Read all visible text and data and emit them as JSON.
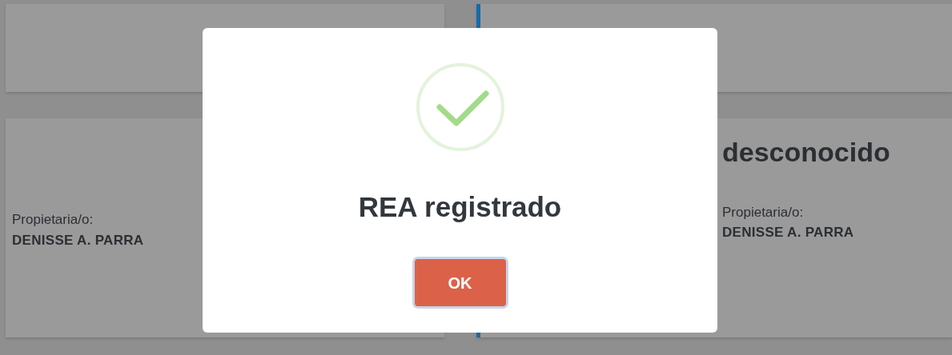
{
  "top_cards": [
    {
      "highlighted": false
    },
    {
      "highlighted": true
    }
  ],
  "cards": [
    {
      "highlighted": false,
      "owner_label": "Propietaria/o:",
      "owner_name": "DENISSE A. PARRA"
    },
    {
      "highlighted": true,
      "heading": "desconocido",
      "owner_label": "Propietaria/o:",
      "owner_name": "DENISSE A. PARRA"
    }
  ],
  "dialog": {
    "title": "REA registrado",
    "button": "OK"
  }
}
